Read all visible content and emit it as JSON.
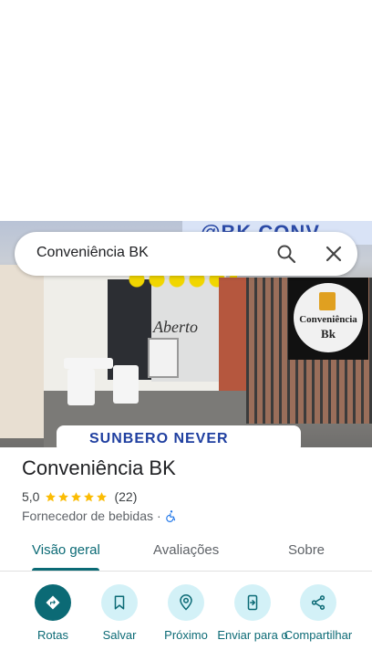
{
  "search": {
    "query": "Conveniência BK"
  },
  "photo": {
    "sign_text": "@BK CONV",
    "door_text": "Aberto",
    "logo_line1": "Conveniência",
    "logo_line2": "Bk",
    "banner_text": "SUNBERO NEVER"
  },
  "place": {
    "name": "Conveniência BK",
    "rating": "5,0",
    "stars": 5,
    "review_count": "(22)",
    "category": "Fornecedor de bebidas",
    "separator": "·"
  },
  "tabs": [
    {
      "label": "Visão geral",
      "active": true
    },
    {
      "label": "Avaliações",
      "active": false
    },
    {
      "label": "Sobre",
      "active": false
    }
  ],
  "actions": [
    {
      "label": "Rotas",
      "icon": "directions-icon"
    },
    {
      "label": "Salvar",
      "icon": "bookmark-icon"
    },
    {
      "label": "Próximo",
      "icon": "nearby-icon"
    },
    {
      "label": "Enviar para o",
      "icon": "send-to-phone-icon"
    },
    {
      "label": "Compartilhar",
      "icon": "share-icon"
    }
  ],
  "colors": {
    "accent": "#0b6a75",
    "action_bg": "#d3f1f7",
    "star": "#fbbc04"
  }
}
